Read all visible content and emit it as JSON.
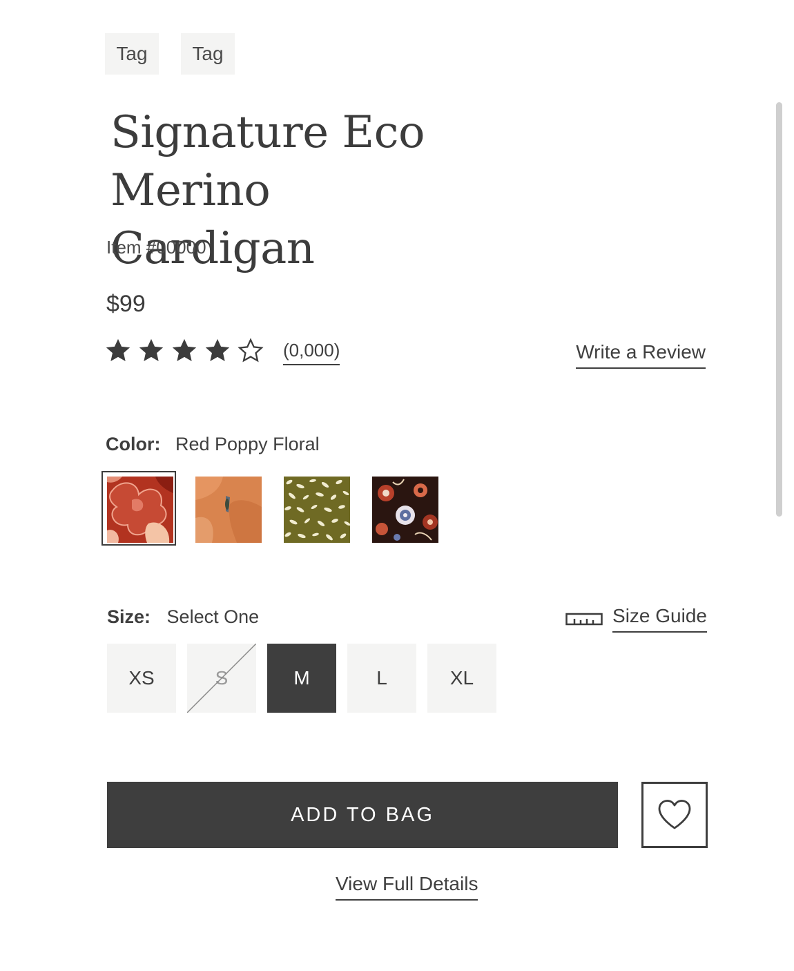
{
  "tags": [
    "Tag",
    "Tag"
  ],
  "product": {
    "title_line1": "Signature Eco Merino",
    "title_line2": "Cardigan",
    "item_number": "Item #00000",
    "price": "$99"
  },
  "rating": {
    "value": 4,
    "out_of": 5,
    "review_count": "(0,000)",
    "write_review": "Write a Review"
  },
  "color": {
    "label": "Color:",
    "selected": "Red Poppy Floral",
    "swatches": [
      {
        "icon": "red-poppy-floral-swatch",
        "selected": true
      },
      {
        "icon": "orange-print-swatch",
        "selected": false
      },
      {
        "icon": "olive-animal-print-swatch",
        "selected": false
      },
      {
        "icon": "dark-paisley-floral-swatch",
        "selected": false
      }
    ]
  },
  "size": {
    "label": "Size:",
    "selected_text": "Select One",
    "guide": "Size Guide",
    "options": [
      {
        "label": "XS",
        "state": "available"
      },
      {
        "label": "S",
        "state": "unavailable"
      },
      {
        "label": "M",
        "state": "selected"
      },
      {
        "label": "L",
        "state": "available"
      },
      {
        "label": "XL",
        "state": "available"
      }
    ]
  },
  "actions": {
    "add_to_bag": "ADD TO BAG",
    "wishlist_icon": "heart-icon",
    "view_details": "View Full Details"
  },
  "colors": {
    "text": "#3f3f3f",
    "dark_button": "#3e3e3e",
    "tag_bg": "#f4f4f3"
  }
}
